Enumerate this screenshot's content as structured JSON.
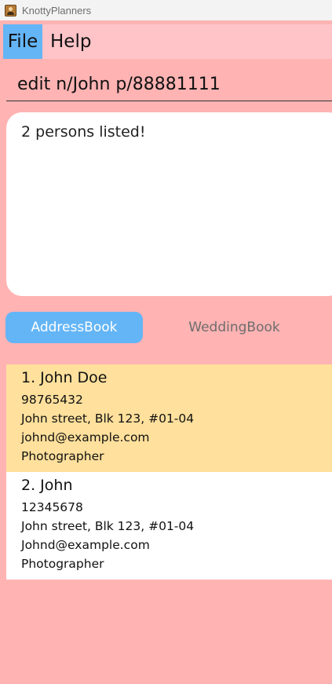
{
  "window": {
    "title": "KnottyPlanners",
    "icon": "contacts-app-icon"
  },
  "menu": {
    "items": [
      "File",
      "Help"
    ]
  },
  "command_box": {
    "value": "edit n/John p/88881111"
  },
  "result_display": {
    "text": "2 persons listed!"
  },
  "tabs": [
    {
      "label": "AddressBook",
      "selected": true
    },
    {
      "label": "WeddingBook",
      "selected": false
    }
  ],
  "persons": [
    {
      "index_name": "1. John Doe",
      "phone": "98765432",
      "address": "John street, Blk 123, #01-04",
      "email": "johnd@example.com",
      "job": "Photographer",
      "selected": true
    },
    {
      "index_name": "2. John",
      "phone": "12345678",
      "address": "John street, Blk 123, #01-04",
      "email": "Johnd@example.com",
      "job": "Photographer",
      "selected": false
    }
  ],
  "colors": {
    "background": "#ffb3b3",
    "menubar": "#ffc4c8",
    "accent": "#64b5f6",
    "selected_card": "#ffe09c"
  }
}
